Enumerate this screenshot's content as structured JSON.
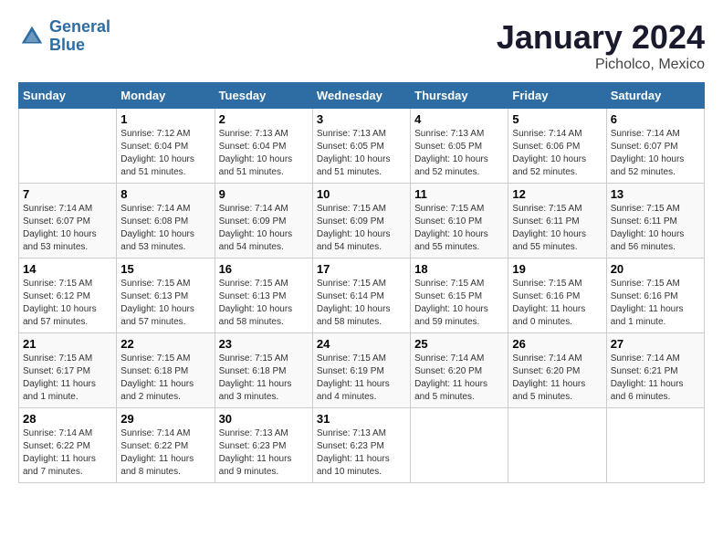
{
  "header": {
    "logo_line1": "General",
    "logo_line2": "Blue",
    "title": "January 2024",
    "subtitle": "Picholco, Mexico"
  },
  "weekdays": [
    "Sunday",
    "Monday",
    "Tuesday",
    "Wednesday",
    "Thursday",
    "Friday",
    "Saturday"
  ],
  "weeks": [
    [
      {
        "num": "",
        "info": ""
      },
      {
        "num": "1",
        "info": "Sunrise: 7:12 AM\nSunset: 6:04 PM\nDaylight: 10 hours\nand 51 minutes."
      },
      {
        "num": "2",
        "info": "Sunrise: 7:13 AM\nSunset: 6:04 PM\nDaylight: 10 hours\nand 51 minutes."
      },
      {
        "num": "3",
        "info": "Sunrise: 7:13 AM\nSunset: 6:05 PM\nDaylight: 10 hours\nand 51 minutes."
      },
      {
        "num": "4",
        "info": "Sunrise: 7:13 AM\nSunset: 6:05 PM\nDaylight: 10 hours\nand 52 minutes."
      },
      {
        "num": "5",
        "info": "Sunrise: 7:14 AM\nSunset: 6:06 PM\nDaylight: 10 hours\nand 52 minutes."
      },
      {
        "num": "6",
        "info": "Sunrise: 7:14 AM\nSunset: 6:07 PM\nDaylight: 10 hours\nand 52 minutes."
      }
    ],
    [
      {
        "num": "7",
        "info": "Sunrise: 7:14 AM\nSunset: 6:07 PM\nDaylight: 10 hours\nand 53 minutes."
      },
      {
        "num": "8",
        "info": "Sunrise: 7:14 AM\nSunset: 6:08 PM\nDaylight: 10 hours\nand 53 minutes."
      },
      {
        "num": "9",
        "info": "Sunrise: 7:14 AM\nSunset: 6:09 PM\nDaylight: 10 hours\nand 54 minutes."
      },
      {
        "num": "10",
        "info": "Sunrise: 7:15 AM\nSunset: 6:09 PM\nDaylight: 10 hours\nand 54 minutes."
      },
      {
        "num": "11",
        "info": "Sunrise: 7:15 AM\nSunset: 6:10 PM\nDaylight: 10 hours\nand 55 minutes."
      },
      {
        "num": "12",
        "info": "Sunrise: 7:15 AM\nSunset: 6:11 PM\nDaylight: 10 hours\nand 55 minutes."
      },
      {
        "num": "13",
        "info": "Sunrise: 7:15 AM\nSunset: 6:11 PM\nDaylight: 10 hours\nand 56 minutes."
      }
    ],
    [
      {
        "num": "14",
        "info": "Sunrise: 7:15 AM\nSunset: 6:12 PM\nDaylight: 10 hours\nand 57 minutes."
      },
      {
        "num": "15",
        "info": "Sunrise: 7:15 AM\nSunset: 6:13 PM\nDaylight: 10 hours\nand 57 minutes."
      },
      {
        "num": "16",
        "info": "Sunrise: 7:15 AM\nSunset: 6:13 PM\nDaylight: 10 hours\nand 58 minutes."
      },
      {
        "num": "17",
        "info": "Sunrise: 7:15 AM\nSunset: 6:14 PM\nDaylight: 10 hours\nand 58 minutes."
      },
      {
        "num": "18",
        "info": "Sunrise: 7:15 AM\nSunset: 6:15 PM\nDaylight: 10 hours\nand 59 minutes."
      },
      {
        "num": "19",
        "info": "Sunrise: 7:15 AM\nSunset: 6:16 PM\nDaylight: 11 hours\nand 0 minutes."
      },
      {
        "num": "20",
        "info": "Sunrise: 7:15 AM\nSunset: 6:16 PM\nDaylight: 11 hours\nand 1 minute."
      }
    ],
    [
      {
        "num": "21",
        "info": "Sunrise: 7:15 AM\nSunset: 6:17 PM\nDaylight: 11 hours\nand 1 minute."
      },
      {
        "num": "22",
        "info": "Sunrise: 7:15 AM\nSunset: 6:18 PM\nDaylight: 11 hours\nand 2 minutes."
      },
      {
        "num": "23",
        "info": "Sunrise: 7:15 AM\nSunset: 6:18 PM\nDaylight: 11 hours\nand 3 minutes."
      },
      {
        "num": "24",
        "info": "Sunrise: 7:15 AM\nSunset: 6:19 PM\nDaylight: 11 hours\nand 4 minutes."
      },
      {
        "num": "25",
        "info": "Sunrise: 7:14 AM\nSunset: 6:20 PM\nDaylight: 11 hours\nand 5 minutes."
      },
      {
        "num": "26",
        "info": "Sunrise: 7:14 AM\nSunset: 6:20 PM\nDaylight: 11 hours\nand 5 minutes."
      },
      {
        "num": "27",
        "info": "Sunrise: 7:14 AM\nSunset: 6:21 PM\nDaylight: 11 hours\nand 6 minutes."
      }
    ],
    [
      {
        "num": "28",
        "info": "Sunrise: 7:14 AM\nSunset: 6:22 PM\nDaylight: 11 hours\nand 7 minutes."
      },
      {
        "num": "29",
        "info": "Sunrise: 7:14 AM\nSunset: 6:22 PM\nDaylight: 11 hours\nand 8 minutes."
      },
      {
        "num": "30",
        "info": "Sunrise: 7:13 AM\nSunset: 6:23 PM\nDaylight: 11 hours\nand 9 minutes."
      },
      {
        "num": "31",
        "info": "Sunrise: 7:13 AM\nSunset: 6:23 PM\nDaylight: 11 hours\nand 10 minutes."
      },
      {
        "num": "",
        "info": ""
      },
      {
        "num": "",
        "info": ""
      },
      {
        "num": "",
        "info": ""
      }
    ]
  ]
}
